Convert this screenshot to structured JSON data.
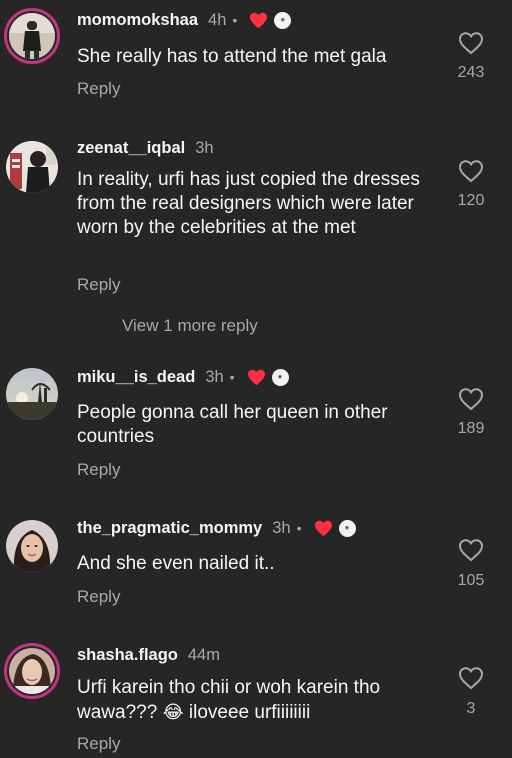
{
  "comments": [
    {
      "username": "momomokshaa",
      "time": "4h",
      "dot": "•",
      "text": "She really has to attend the met gala",
      "reply_label": "Reply",
      "likes": "243",
      "creator_liked": true
    },
    {
      "username": "zeenat__iqbal",
      "time": "3h",
      "text": "In reality, urfi has just copied the dresses from the real designers which were later worn by the celebrities at the met",
      "reply_label": "Reply",
      "likes": "120",
      "creator_liked": false
    },
    {
      "username": "miku__is_dead",
      "time": "3h",
      "dot": "•",
      "text": "People gonna call her queen in other countries",
      "reply_label": "Reply",
      "likes": "189",
      "creator_liked": true
    },
    {
      "username": "the_pragmatic_mommy",
      "time": "3h",
      "dot": "•",
      "text": "And she even nailed it..",
      "reply_label": "Reply",
      "likes": "105",
      "creator_liked": true
    },
    {
      "username": "shasha.flago",
      "time": "44m",
      "text_part1": "Urfi karein tho chii or woh karein tho wawa???",
      "emoji": "😂",
      "text_part2": "iloveee urfiiiiiiii",
      "reply_label": "Reply",
      "likes": "3",
      "creator_liked": false
    }
  ],
  "view_more_replies": "View 1 more reply",
  "colors": {
    "background": "#262626",
    "primary_text": "#f5f5f5",
    "secondary_text": "#a8a8a8",
    "heart_red": "#ff3040",
    "story_ring": "#c13584"
  },
  "icons": {
    "like": "heart-outline-icon",
    "creator_like": "heart-filled-icon"
  }
}
